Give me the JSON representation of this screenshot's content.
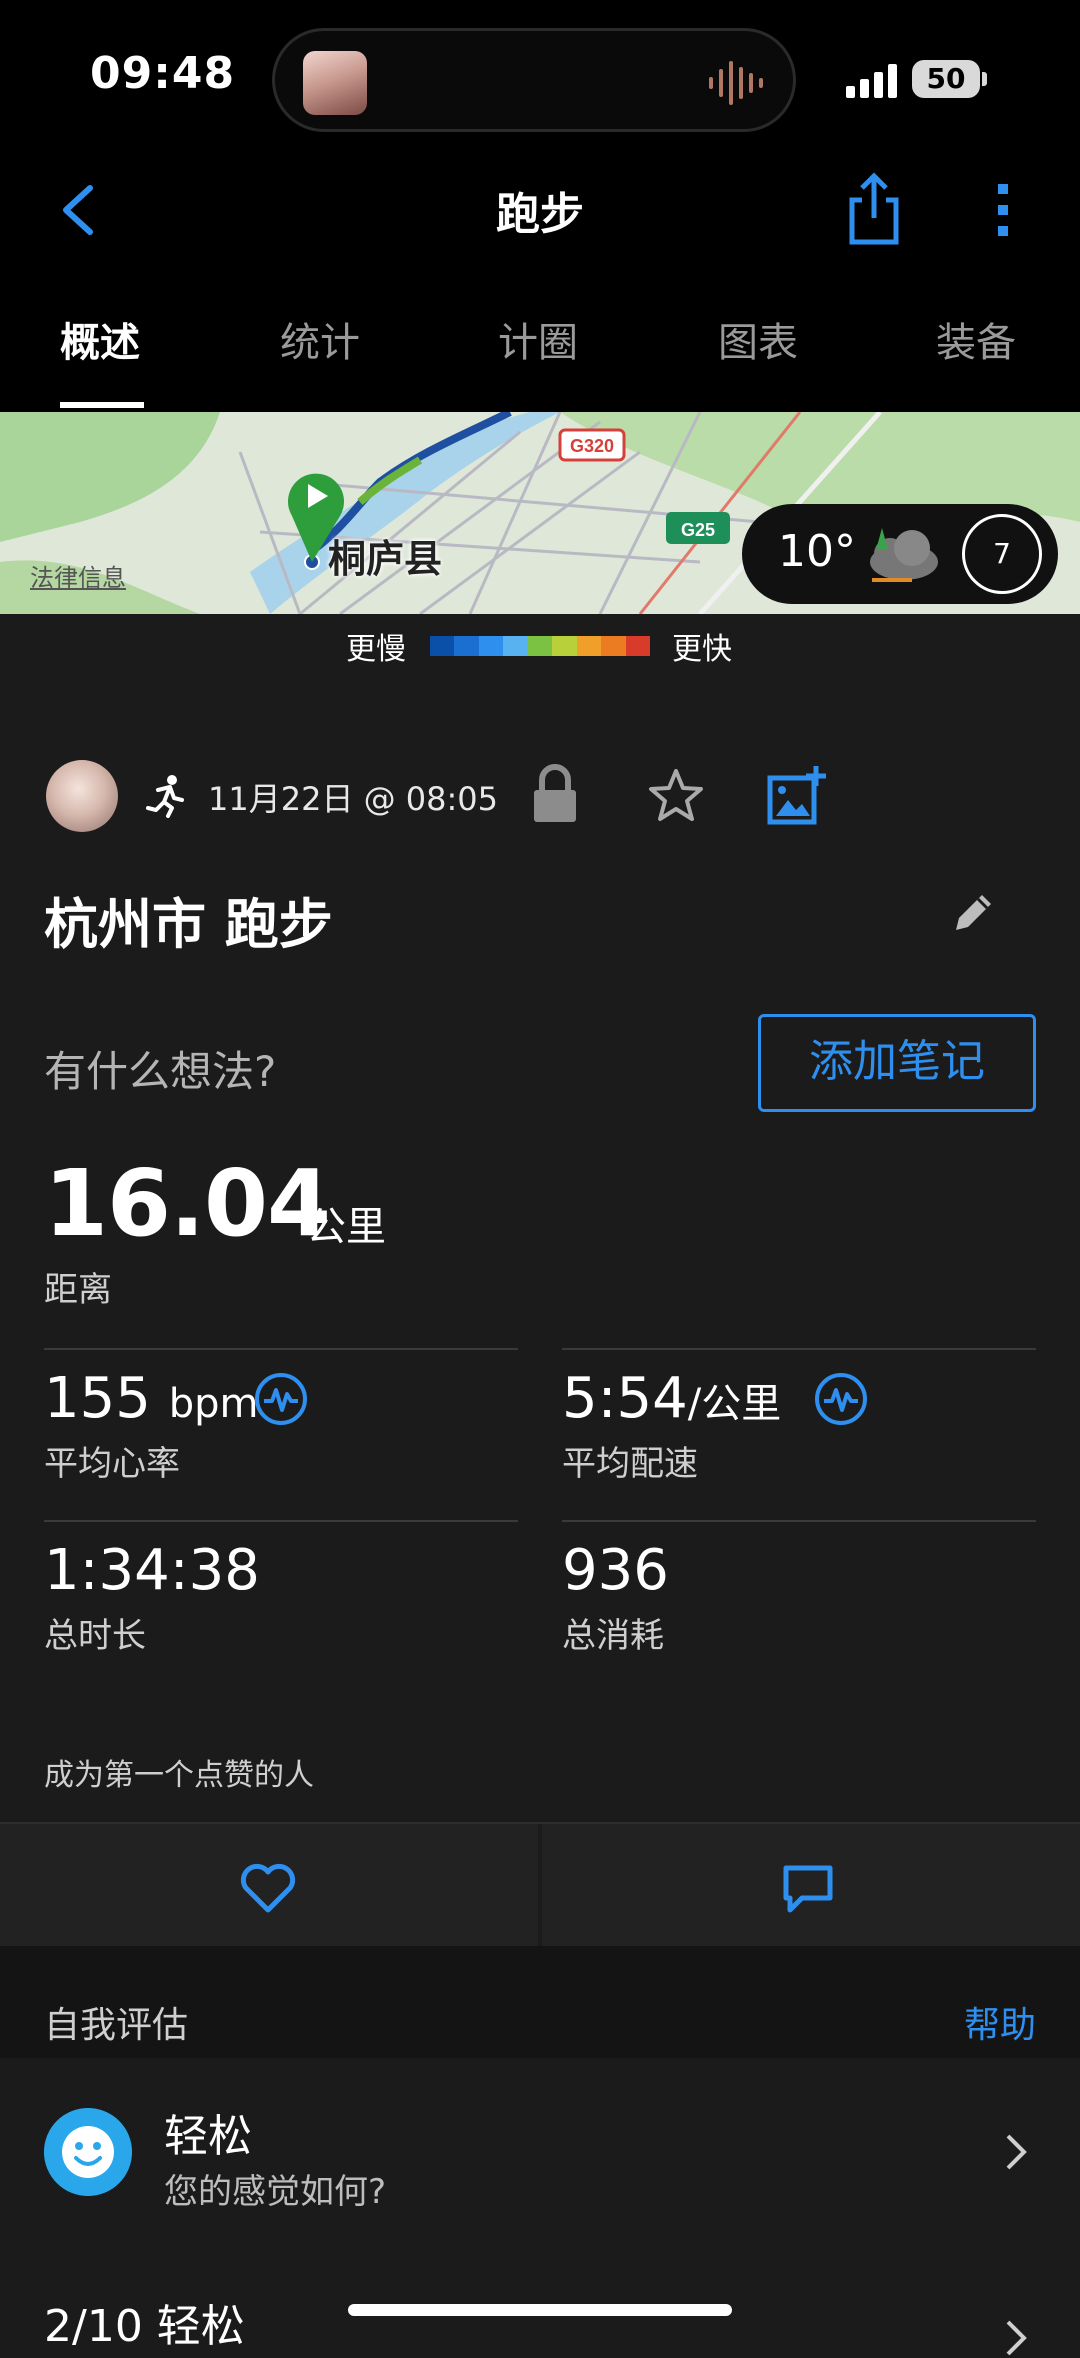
{
  "status": {
    "time": "09:48",
    "battery": "50"
  },
  "nav": {
    "title": "跑步"
  },
  "tabs": [
    "概述",
    "统计",
    "计圈",
    "图表",
    "装备"
  ],
  "map": {
    "city_label": "桐庐县",
    "legal": "法律信息",
    "road_g320": "G320",
    "road_g25": "G25",
    "weather_temp": "10°",
    "wind_speed": "7"
  },
  "legend": {
    "slow": "更慢",
    "fast": "更快",
    "colors": [
      "#0a4fa8",
      "#1b6fd0",
      "#2f8fef",
      "#58b2f0",
      "#7cc242",
      "#b8d13a",
      "#f0a02a",
      "#ec7c22",
      "#d93b2a"
    ]
  },
  "activity": {
    "datetime": "11月22日 @ 08:05",
    "title": "杭州市 跑步",
    "thoughts_prompt": "有什么想法?",
    "add_note": "添加笔记"
  },
  "stats": {
    "distance": {
      "value": "16.04",
      "unit": "公里",
      "label": "距离"
    },
    "heart_rate": {
      "value": "155",
      "unit": "bpm",
      "label": "平均心率"
    },
    "pace": {
      "value": "5:54",
      "unit": "/公里",
      "label": "平均配速"
    },
    "duration": {
      "value": "1:34:38",
      "label": "总时长"
    },
    "calories": {
      "value": "936",
      "label": "总消耗"
    }
  },
  "social": {
    "likes_text": "成为第一个点赞的人"
  },
  "self_assessment": {
    "title": "自我评估",
    "help": "帮助",
    "feel_title": "轻松",
    "feel_subtitle": "您的感觉如何?",
    "effort": "2/10 轻松"
  },
  "colors": {
    "accent": "#2f8fef",
    "background": "#1b1b1b"
  }
}
